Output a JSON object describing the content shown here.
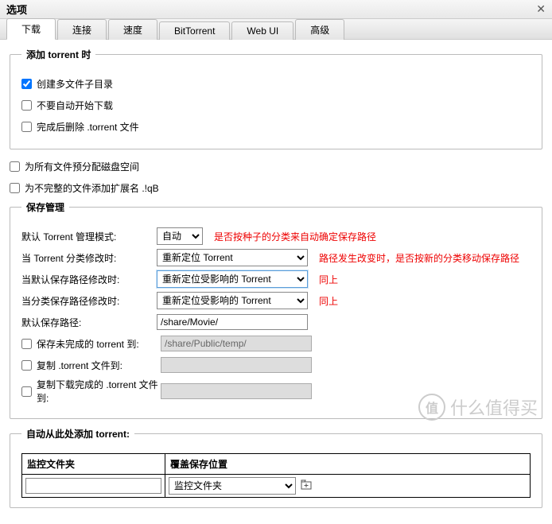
{
  "dialog": {
    "title": "选项"
  },
  "tabs": {
    "download": "下载",
    "connection": "连接",
    "speed": "速度",
    "bittorrent": "BitTorrent",
    "webui": "Web UI",
    "advanced": "高级"
  },
  "section_add": {
    "legend": "添加 torrent 时",
    "create_subfolder": "创建多文件子目录",
    "no_autostart": "不要自动开始下载",
    "delete_torrent": "完成后删除 .torrent 文件"
  },
  "misc": {
    "preallocate": "为所有文件预分配磁盘空间",
    "append_ext": "为不完整的文件添加扩展名 .!qB"
  },
  "section_save": {
    "legend": "保存管理",
    "default_mode_label": "默认 Torrent 管理模式:",
    "default_mode_value": "自动",
    "default_mode_note": "是否按种子的分类来自动确定保存路径",
    "category_change_label": "当 Torrent 分类修改时:",
    "category_change_value": "重新定位 Torrent",
    "category_change_note": "路径发生改变时，是否按新的分类移动保存路径",
    "default_path_change_label": "当默认保存路径修改时:",
    "default_path_change_value": "重新定位受影响的 Torrent",
    "default_path_change_note": "同上",
    "category_path_change_label": "当分类保存路径修改时:",
    "category_path_change_value": "重新定位受影响的 Torrent",
    "category_path_change_note": "同上",
    "default_save_label": "默认保存路径:",
    "default_save_value": "/share/Movie/",
    "save_incomplete": "保存未完成的 torrent 到:",
    "save_incomplete_value": "/share/Public/temp/",
    "copy_torrent": "复制 .torrent 文件到:",
    "copy_torrent_value": "",
    "copy_finished": "复制下载完成的 .torrent 文件到:",
    "copy_finished_value": ""
  },
  "section_auto": {
    "legend": "自动从此处添加 torrent:",
    "col_folder": "监控文件夹",
    "col_override": "覆盖保存位置",
    "row_folder_value": "",
    "row_override_value": "监控文件夹"
  },
  "watermark": {
    "icon_text": "值",
    "text": "什么值得买"
  }
}
